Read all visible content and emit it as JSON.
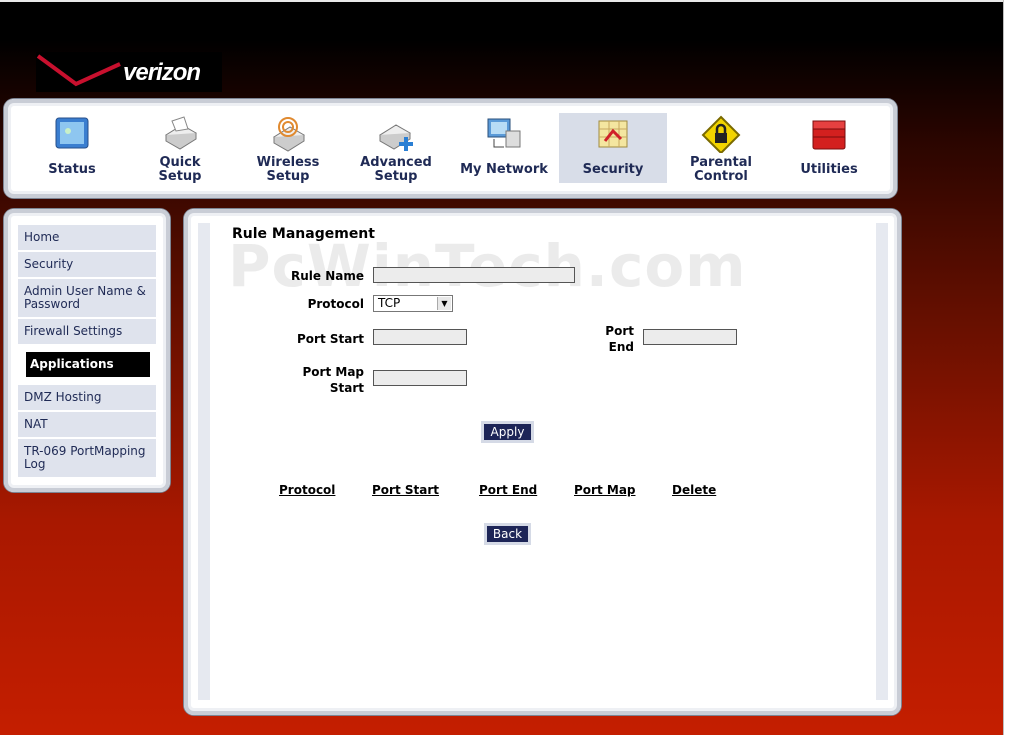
{
  "brand": {
    "logo_text": "verizon"
  },
  "nav": {
    "items": [
      {
        "label": "Status",
        "icon": "status-icon"
      },
      {
        "label": "Quick\nSetup",
        "icon": "quick-setup-icon"
      },
      {
        "label": "Wireless\nSetup",
        "icon": "wireless-setup-icon"
      },
      {
        "label": "Advanced\nSetup",
        "icon": "advanced-setup-icon"
      },
      {
        "label": "My Network",
        "icon": "my-network-icon"
      },
      {
        "label": "Security",
        "icon": "security-icon",
        "active": true
      },
      {
        "label": "Parental\nControl",
        "icon": "parental-control-icon"
      },
      {
        "label": "Utilities",
        "icon": "utilities-icon"
      }
    ]
  },
  "sidebar": {
    "items": [
      {
        "label": "Home"
      },
      {
        "label": "Security"
      },
      {
        "label": "Admin User Name &\nPassword"
      },
      {
        "label": "Firewall Settings"
      },
      {
        "label": "Applications",
        "active": true
      },
      {
        "label": "DMZ Hosting"
      },
      {
        "label": "NAT"
      },
      {
        "label": "TR-069 PortMapping\nLog"
      }
    ]
  },
  "main": {
    "title": "Rule Management",
    "watermark": "PcWinTech.com",
    "form": {
      "rule_name_label": "Rule Name",
      "rule_name_value": "",
      "protocol_label": "Protocol",
      "protocol_value": "TCP",
      "port_start_label": "Port Start",
      "port_start_value": "",
      "port_end_label": "Port\nEnd",
      "port_end_value": "",
      "port_map_start_label": "Port Map\nStart",
      "port_map_start_value": ""
    },
    "apply_label": "Apply",
    "table_headers": [
      "Protocol",
      "Port Start",
      "Port End",
      "Port Map",
      "Delete"
    ],
    "back_label": "Back"
  },
  "colors": {
    "nav_text": "#1f2a55",
    "button_bg": "#1d2557",
    "active_nav_bg": "#d8dde8",
    "background_top": "#000000",
    "background_bottom": "#c41e00"
  }
}
